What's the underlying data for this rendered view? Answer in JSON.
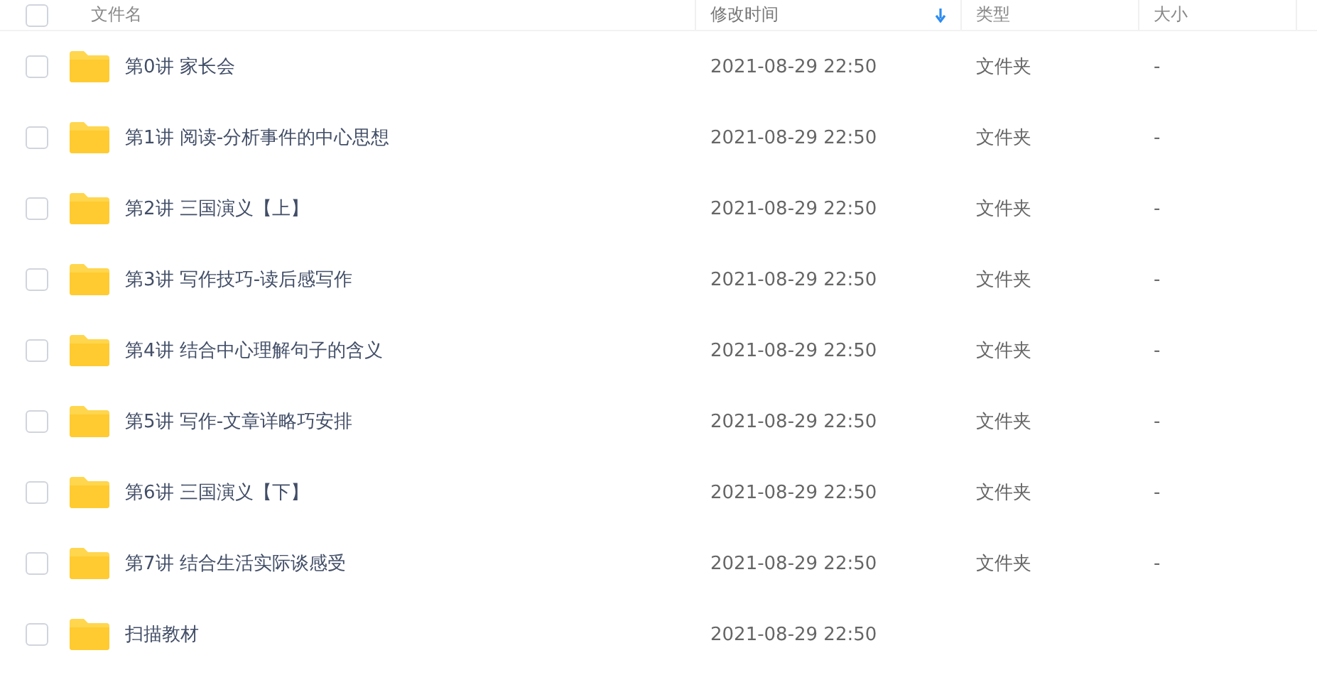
{
  "table": {
    "select_all_checked": false,
    "columns": [
      {
        "label": "文件名",
        "sorted": false
      },
      {
        "label": "修改时间",
        "sorted": true
      },
      {
        "label": "类型",
        "sorted": false
      },
      {
        "label": "大小",
        "sorted": false
      }
    ],
    "rows": [
      {
        "name": "第0讲 家长会",
        "modified": "2021-08-29 22:50",
        "type": "文件夹",
        "size": "-",
        "checked": false
      },
      {
        "name": "第1讲 阅读-分析事件的中心思想",
        "modified": "2021-08-29 22:50",
        "type": "文件夹",
        "size": "-",
        "checked": false
      },
      {
        "name": "第2讲 三国演义【上】",
        "modified": "2021-08-29 22:50",
        "type": "文件夹",
        "size": "-",
        "checked": false
      },
      {
        "name": "第3讲 写作技巧-读后感写作",
        "modified": "2021-08-29 22:50",
        "type": "文件夹",
        "size": "-",
        "checked": false
      },
      {
        "name": "第4讲 结合中心理解句子的含义",
        "modified": "2021-08-29 22:50",
        "type": "文件夹",
        "size": "-",
        "checked": false
      },
      {
        "name": "第5讲 写作-文章详略巧安排",
        "modified": "2021-08-29 22:50",
        "type": "文件夹",
        "size": "-",
        "checked": false
      },
      {
        "name": "第6讲 三国演义【下】",
        "modified": "2021-08-29 22:50",
        "type": "文件夹",
        "size": "-",
        "checked": false
      },
      {
        "name": "第7讲 结合生活实际谈感受",
        "modified": "2021-08-29 22:50",
        "type": "文件夹",
        "size": "-",
        "checked": false
      },
      {
        "name": "扫描教材",
        "modified": "2021-08-29 22:50",
        "checked": false
      }
    ]
  }
}
